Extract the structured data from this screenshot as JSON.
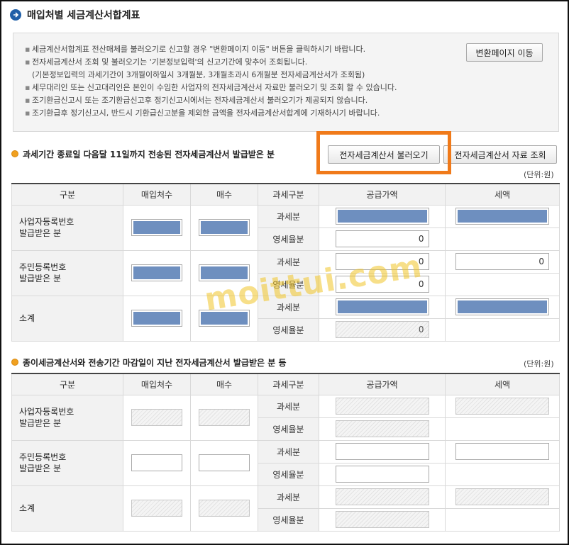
{
  "page": {
    "title": "매입처별 세금계산서합계표",
    "convert_button": "변환페이지 이동"
  },
  "notices": [
    "세금계산서합계표 전산매체를 불러오기로 신고할 경우 \"변환페이지 이동\" 버튼을 클릭하시기 바랍니다.",
    "전자세금계산서 조회 및 불러오기는 '기본정보입력'의 신고기간에 맞추어 조회됩니다.",
    "(기본정보입력의 과세기간이 3개월이하일시 3개월분, 3개월초과시 6개월분 전자세금계산서가 조회됨)",
    "세무대리인 또는 신고대리인은 본인이 수임한 사업자의 전자세금계산서 자료만 불러오기 및 조회 할 수 있습니다.",
    "조기환급신고시 또는 조기환급신고후 정기신고시에서는 전자세금계산서 불러오기가 제공되지 않습니다.",
    "조기환급후 정기신고시, 반드시 기환급신고분을 제외한 금액을 전자세금계산서합계에 기재하시기 바랍니다."
  ],
  "section1": {
    "heading": "과세기간 종료일 다음달 11일까지 전송된 전자세금계산서 발급받은 분",
    "load_button": "전자세금계산서 불러오기",
    "lookup_button": "전자세금계산서 자료 조회",
    "unit": "(단위:원)",
    "columns": [
      "구분",
      "매입처수",
      "매수",
      "과세구분",
      "공급가액",
      "세액"
    ],
    "rows": {
      "business": "사업자등록번호\n발급받은 분",
      "resident": "주민등록번호\n발급받은 분",
      "subtotal": "소계"
    },
    "sub_taxable": "과세분",
    "sub_zero": "영세율분",
    "values": {
      "business_zero_supply": "0",
      "resident_taxable_supply": "0",
      "resident_taxable_tax": "0",
      "resident_zero_supply": "0",
      "subtotal_zero_supply": "0"
    }
  },
  "section2": {
    "heading": "종이세금계산서와 전송기간 마감일이 지난 전자세금계산서 발급받은 분 등",
    "unit": "(단위:원)",
    "columns": [
      "구분",
      "매입처수",
      "매수",
      "과세구분",
      "공급가액",
      "세액"
    ],
    "rows": {
      "business": "사업자등록번호\n발급받은 분",
      "resident": "주민등록번호\n발급받은 분",
      "subtotal": "소계"
    },
    "sub_taxable": "과세분",
    "sub_zero": "영세율분"
  },
  "watermark": "moittui.com",
  "colors": {
    "highlight": "#f07a1a",
    "masked_fill": "#6e8fbf",
    "title_icon": "#1f5fa8",
    "bullet": "#f0a020"
  }
}
